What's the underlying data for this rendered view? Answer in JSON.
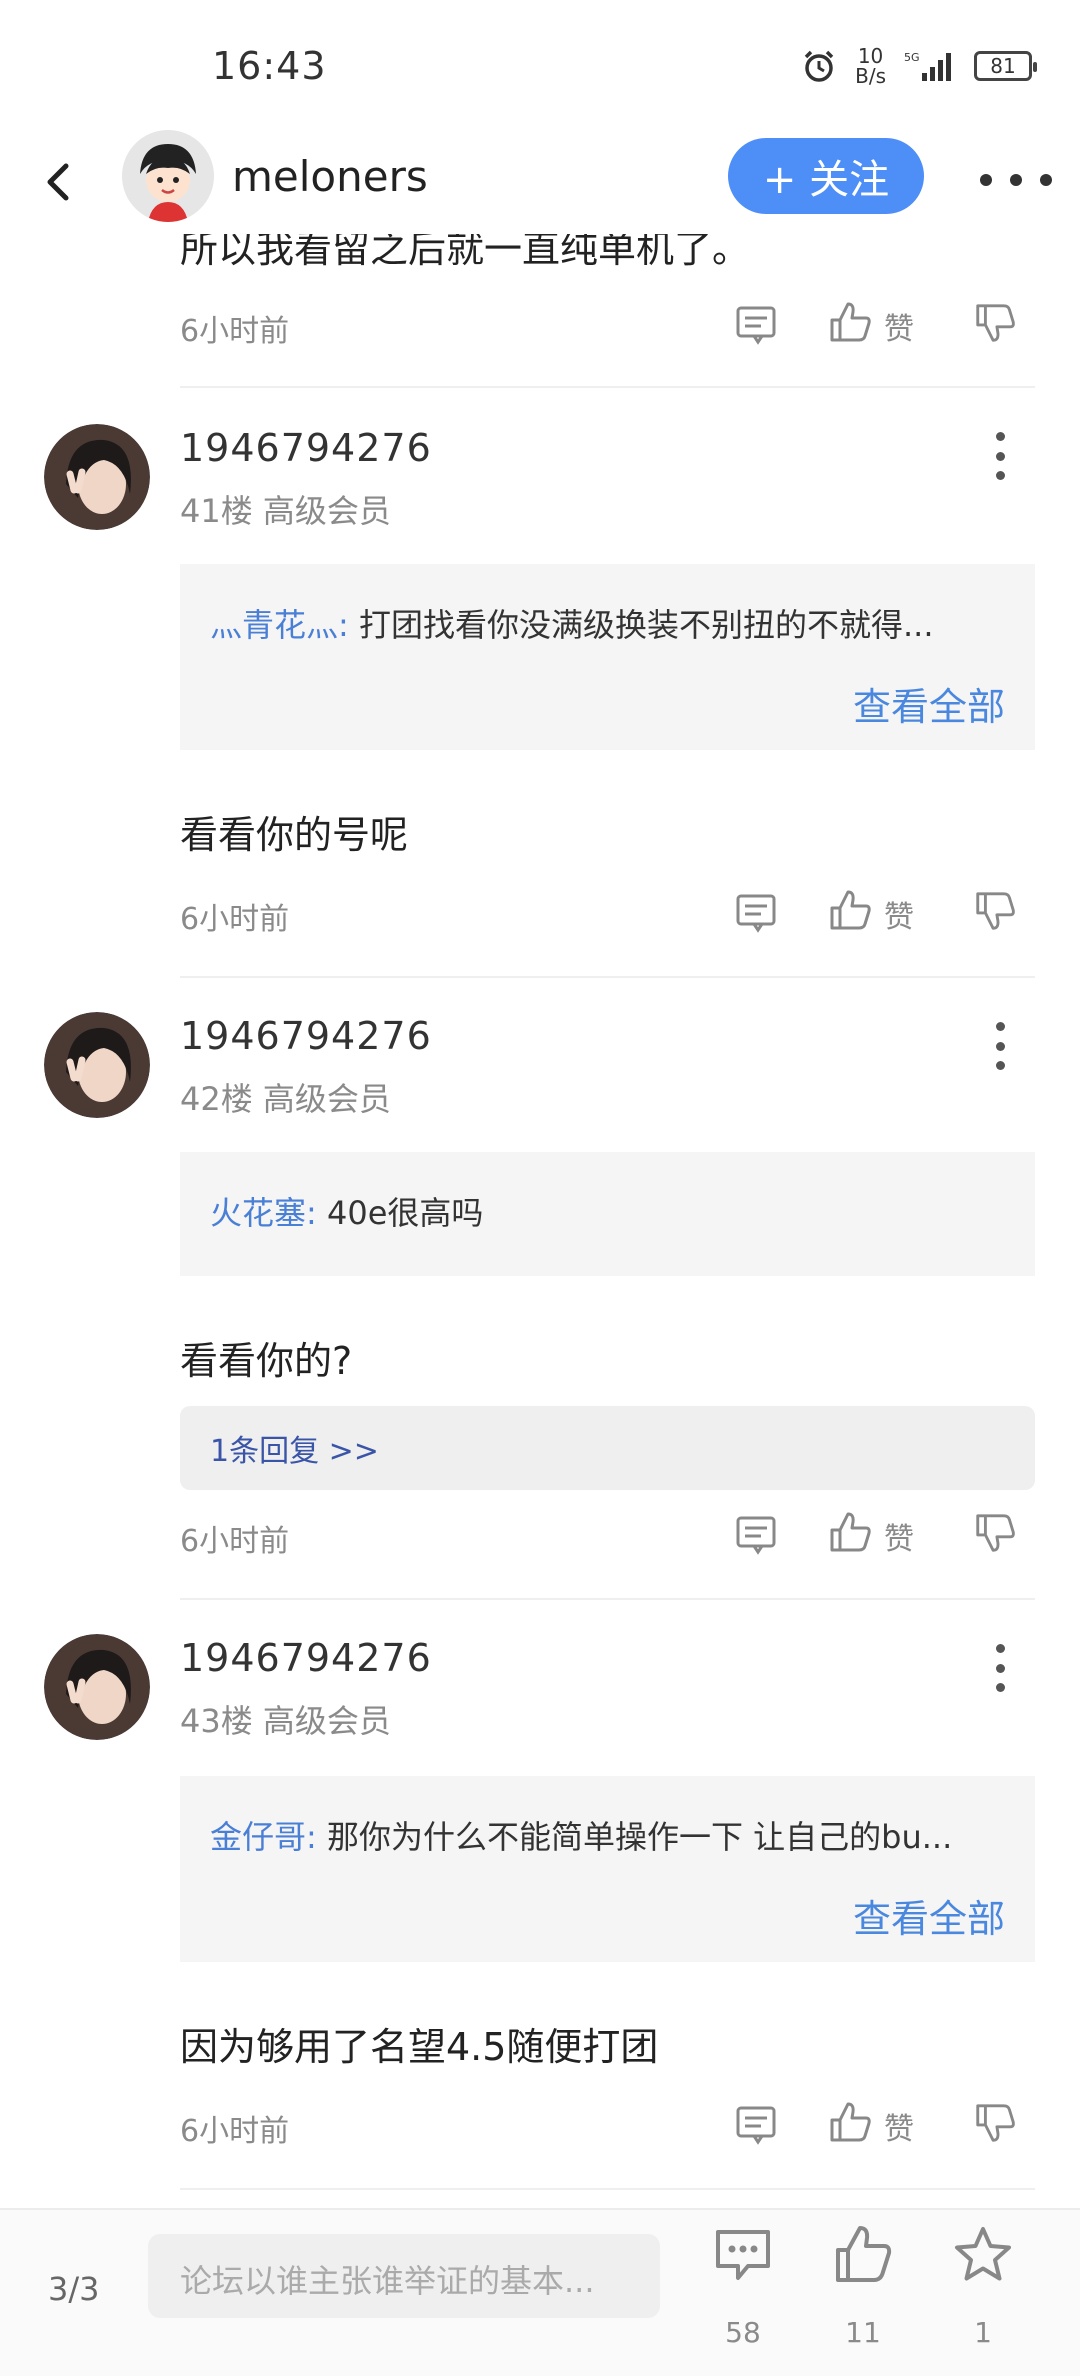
{
  "status_bar": {
    "time": "16:43",
    "net_speed_value": "10",
    "net_speed_unit": "B/s",
    "signal": "5G",
    "battery": "81"
  },
  "header": {
    "username": "meloners",
    "follow_label": "+ 关注"
  },
  "clipped_text": "所以我看留之后就一直纯单机了。",
  "post0": {
    "time": "6小时前",
    "like_label": "赞"
  },
  "posts": [
    {
      "username": "1946794276",
      "floor": "41楼",
      "rank": "高级会员",
      "quote_author": "灬青花灬:",
      "quote_text": " 打团找看你没满级换装不别扭的不就得...",
      "view_all": "查看全部",
      "content": "看看你的号呢",
      "time": "6小时前",
      "like_label": "赞"
    },
    {
      "username": "1946794276",
      "floor": "42楼",
      "rank": "高级会员",
      "quote_author": "火花塞:",
      "quote_text": " 40e很高吗",
      "content": "看看你的?",
      "replies_label": "1条回复 >>",
      "time": "6小时前",
      "like_label": "赞"
    },
    {
      "username": "1946794276",
      "floor": "43楼",
      "rank": "高级会员",
      "quote_author": "金仔哥:",
      "quote_text": " 那你为什么不能简单操作一下 让自己的bu...",
      "view_all": "查看全部",
      "content": "因为够用了名望4.5随便打团",
      "time": "6小时前",
      "like_label": "赞"
    }
  ],
  "bottom_bar": {
    "pager": "3/3",
    "input_placeholder": "论坛以谁主张谁举证的基本...",
    "comments_count": "58",
    "likes_count": "11",
    "favorites_count": "1"
  },
  "icons": [
    "back-icon",
    "alarm-icon",
    "comment-icon",
    "like-icon",
    "dislike-icon",
    "more-icon",
    "star-icon"
  ],
  "colors": {
    "accent": "#4e8ef7",
    "link": "#4a88e0",
    "quote_author": "#4a7fd6",
    "reply_link": "#3a55a8"
  }
}
